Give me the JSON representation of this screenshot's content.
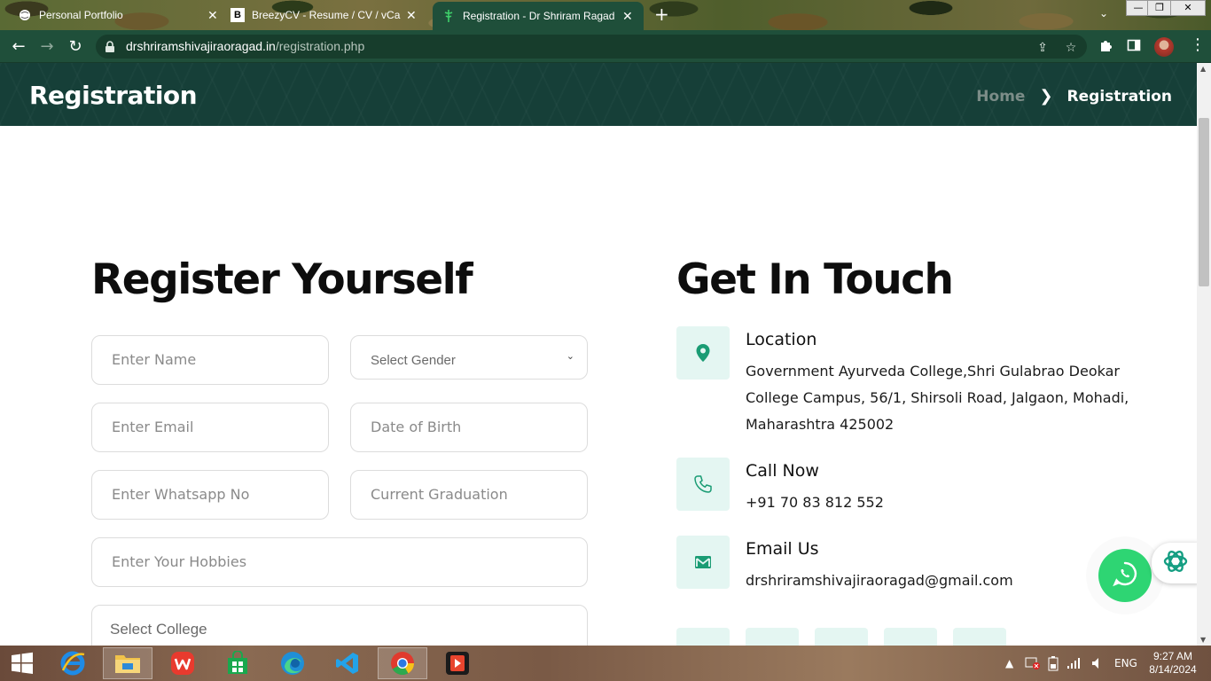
{
  "browser": {
    "tabs": [
      {
        "title": "Personal Portfolio",
        "active": false
      },
      {
        "title": "BreezyCV - Resume / CV / vCard",
        "active": false
      },
      {
        "title": "Registration - Dr Shriram Ragad",
        "active": true
      }
    ],
    "url_domain": "drshriramshivajiraoragad.in",
    "url_path": "/registration.php"
  },
  "page": {
    "banner_title": "Registration",
    "breadcrumb": {
      "home": "Home",
      "current": "Registration"
    },
    "form": {
      "heading": "Register Yourself",
      "name_placeholder": "Enter Name",
      "gender_placeholder": "Select  Gender",
      "email_placeholder": "Enter Email",
      "dob_placeholder": "Date of Birth",
      "whatsapp_placeholder": "Enter Whatsapp No",
      "graduation_placeholder": "Current Graduation",
      "hobbies_placeholder": "Enter Your Hobbies",
      "college_placeholder": "Select College"
    },
    "contact": {
      "heading": "Get In Touch",
      "location_label": "Location",
      "location_value": "Government Ayurveda College,Shri Gulabrao Deokar College Campus, 56/1, Shirsoli Road, Jalgaon, Mohadi, Maharashtra 425002",
      "call_label": "Call Now",
      "call_value": "+91 70 83 812 552",
      "email_label": "Email Us",
      "email_value": "drshriramshivajiraoragad@gmail.com"
    },
    "colors": {
      "banner": "#163f38",
      "accent": "#1a9c74",
      "icon_bg": "#e4f6f2",
      "whatsapp": "#2ed573"
    }
  },
  "taskbar": {
    "time": "9:27 AM",
    "date": "8/14/2024",
    "language": "ENG"
  }
}
